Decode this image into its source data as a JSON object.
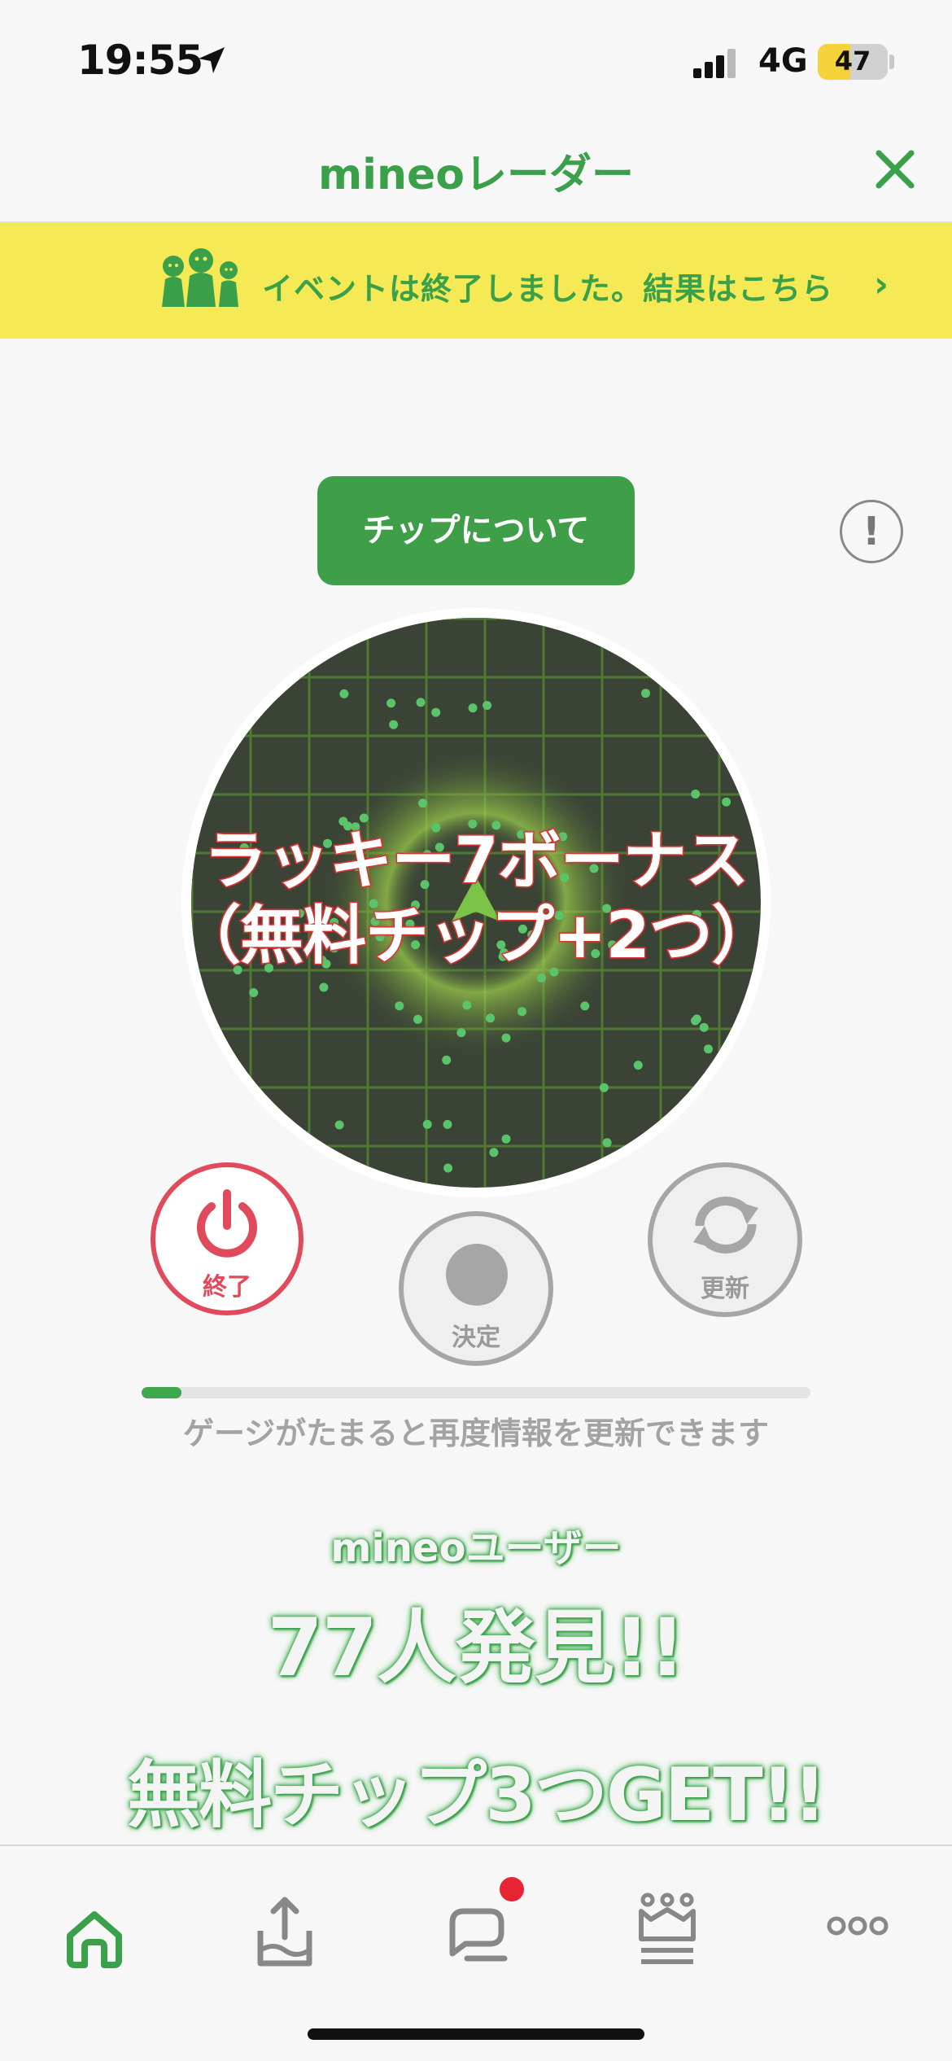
{
  "status_bar": {
    "time": "19:55",
    "network": "4G",
    "battery": "47"
  },
  "header": {
    "title": "mineoレーダー"
  },
  "banner": {
    "text": "イベントは終了しました。結果はこちら"
  },
  "chip_button": {
    "label": "チップについて"
  },
  "info_button": {
    "label": "!"
  },
  "radar": {
    "overlay_line1": "ラッキー7ボーナス",
    "overlay_line2": "（無料チップ+2つ）"
  },
  "controls": {
    "end_label": "終了",
    "decide_label": "決定",
    "refresh_label": "更新"
  },
  "gauge": {
    "progress": 0.06,
    "caption": "ゲージがたまると再度情報を更新できます"
  },
  "result": {
    "users_label": "mineoユーザー",
    "found": "77人発見!!",
    "chips": "無料チップ3つGET!!"
  },
  "tabs": [
    {
      "icon": "home-icon",
      "active": true
    },
    {
      "icon": "upload-tray-icon",
      "active": false
    },
    {
      "icon": "chat-icon",
      "active": false,
      "badge": true
    },
    {
      "icon": "crown-icon",
      "active": false
    },
    {
      "icon": "more-icon",
      "active": false
    }
  ],
  "colors": {
    "brand_green": "#3aa04a",
    "banner_yellow": "#f5ea55",
    "end_red": "#e04a5a",
    "badge_red": "#e82333"
  }
}
